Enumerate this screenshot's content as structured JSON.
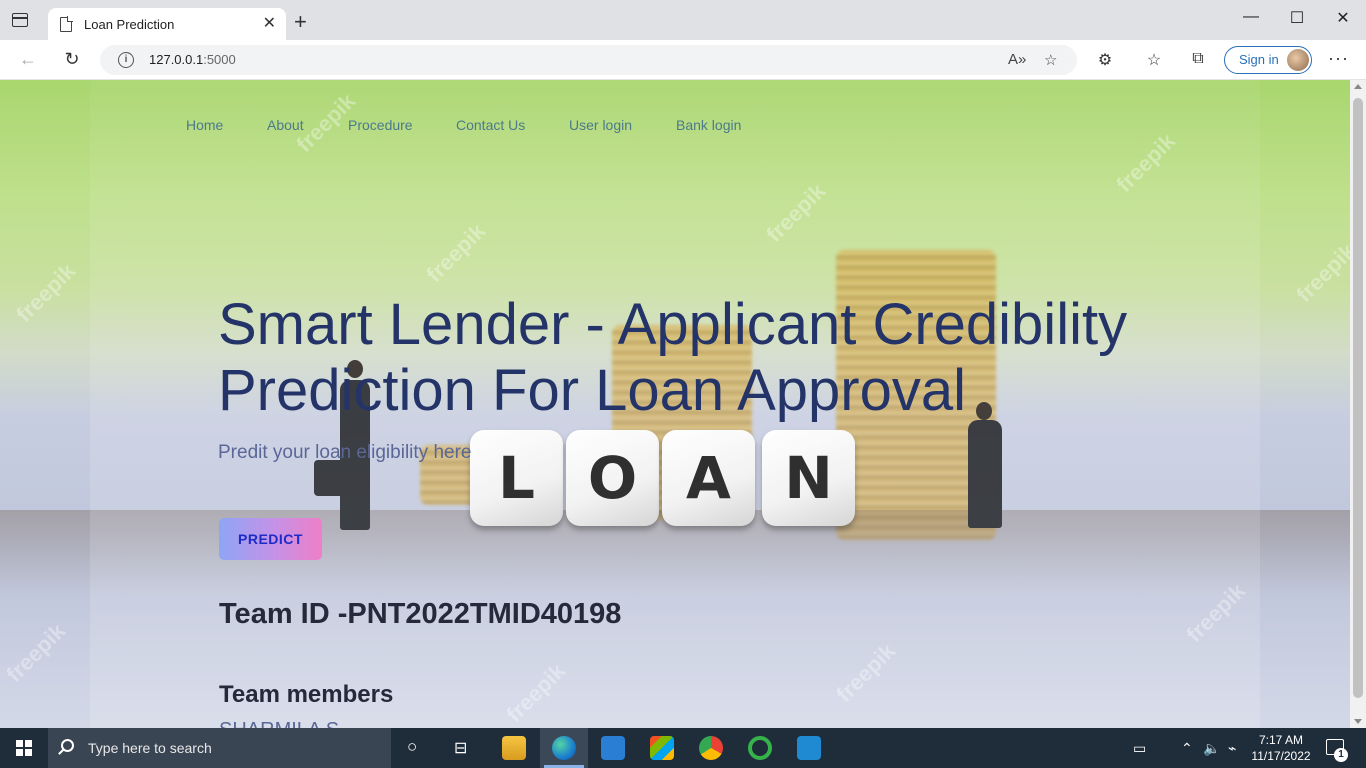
{
  "browser": {
    "tab_title": "Loan Prediction",
    "url_host": "127.0.0.1",
    "url_port": ":5000",
    "sign_in_label": "Sign in"
  },
  "nav": {
    "items": [
      {
        "label": "Home"
      },
      {
        "label": "About"
      },
      {
        "label": "Procedure"
      },
      {
        "label": "Contact Us"
      },
      {
        "label": "User login"
      },
      {
        "label": "Bank login"
      }
    ]
  },
  "hero": {
    "title": "Smart Lender - Applicant Credibility Prediction For Loan Approval",
    "subtitle": "Predit your loan eligibility here",
    "button_label": "PREDICT",
    "background_dice": [
      "L",
      "O",
      "A",
      "N"
    ],
    "watermark": "freepik"
  },
  "team": {
    "id_text": "Team ID -PNT2022TMID40198",
    "members_heading": "Team members",
    "first_member_partial": "SHARMILA S"
  },
  "taskbar": {
    "search_placeholder": "Type here to search",
    "time": "7:17 AM",
    "date": "11/17/2022",
    "notification_count": "1"
  },
  "colors": {
    "title": "#243469",
    "nav_link": "#4c7a8a",
    "button_gradient_start": "#8fa5f5",
    "button_gradient_end": "#ee7fc8",
    "button_text": "#1d2cc8",
    "taskbar": "#1f2c3a"
  }
}
